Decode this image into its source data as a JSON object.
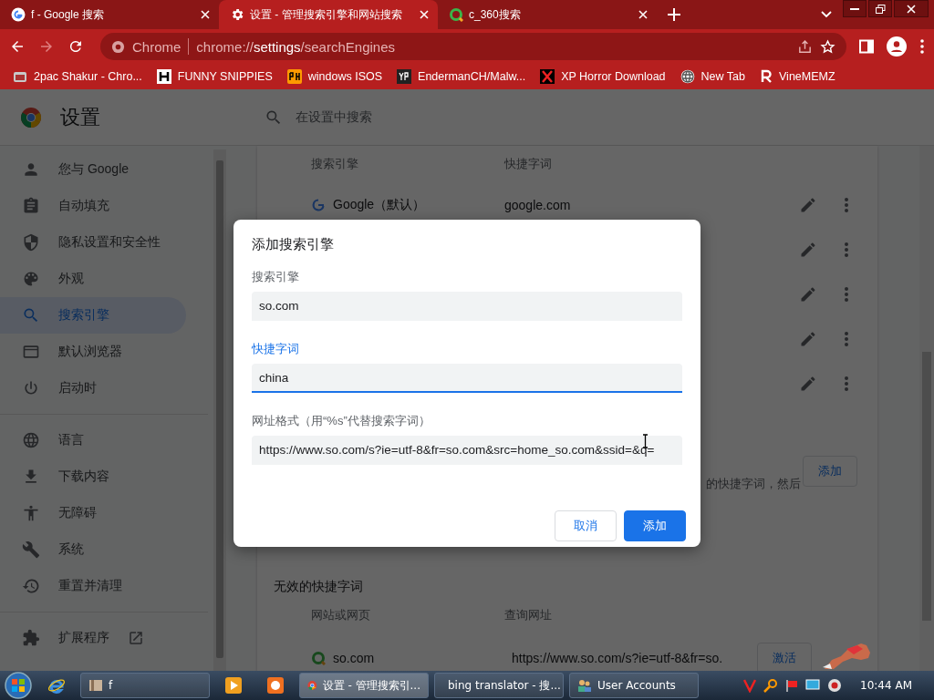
{
  "tabs": [
    {
      "title": "f - Google 搜索",
      "selected": false
    },
    {
      "title": "设置 - 管理搜索引擎和网站搜索",
      "selected": true
    },
    {
      "title": "c_360搜索",
      "selected": false
    }
  ],
  "toolbar": {
    "chip": "Chrome",
    "url": {
      "scheme": "chrome://",
      "host": "settings",
      "path": "/searchEngines"
    }
  },
  "bookmarks": [
    "2pac Shakur - Chro...",
    "FUNNY SNIPPIES",
    "windows ISOS",
    "EndermanCH/Malw...",
    "XP Horror Download",
    "New Tab",
    "VineMEMZ"
  ],
  "settings": {
    "title": "设置",
    "search": {
      "placeholder": "在设置中搜索"
    },
    "sidebar": {
      "groups": [
        [
          {
            "label": "您与 Google",
            "selected": false,
            "external": false
          },
          {
            "label": "自动填充",
            "selected": false,
            "external": false
          },
          {
            "label": "隐私设置和安全性",
            "selected": false,
            "external": false
          },
          {
            "label": "外观",
            "selected": false,
            "external": false
          },
          {
            "label": "搜索引擎",
            "selected": true,
            "external": false
          },
          {
            "label": "默认浏览器",
            "selected": false,
            "external": false
          },
          {
            "label": "启动时",
            "selected": false,
            "external": false
          }
        ],
        [
          {
            "label": "语言",
            "selected": false,
            "external": false
          },
          {
            "label": "下载内容",
            "selected": false,
            "external": false
          },
          {
            "label": "无障碍",
            "selected": false,
            "external": false
          },
          {
            "label": "系统",
            "selected": false,
            "external": false
          },
          {
            "label": "重置并清理",
            "selected": false,
            "external": false
          }
        ],
        [
          {
            "label": "扩展程序",
            "selected": false,
            "external": true
          }
        ]
      ]
    },
    "engines": {
      "columns": [
        "搜索引擎",
        "快捷字词"
      ],
      "rows": [
        {
          "name": "Google（默认）",
          "keyword": "google.com"
        },
        {},
        {},
        {},
        {}
      ]
    },
    "site_search": {
      "description": "的快捷字词，然后",
      "button": "添加"
    },
    "inactive": {
      "title": "无效的快捷字词",
      "columns": [
        "网站或网页",
        "查询网址"
      ],
      "rows": [
        {
          "name": "so.com",
          "url": "https://www.so.com/s?ie=utf-8&fr=so.",
          "button": "激活"
        }
      ]
    }
  },
  "dialog": {
    "title": "添加搜索引擎",
    "fields": [
      {
        "label": "搜索引擎",
        "value": "so.com",
        "focused": false
      },
      {
        "label": "快捷字词",
        "value": "china",
        "focused": true
      },
      {
        "label": "网址格式（用“%s”代替搜索字词）",
        "value": "https://www.so.com/s?ie=utf-8&fr=so.com&src=home_so.com&ssid=&q=",
        "focused": false
      }
    ],
    "buttons": [
      {
        "label": "取消",
        "kind": "secondary"
      },
      {
        "label": "添加",
        "kind": "primary"
      }
    ]
  },
  "taskbar": {
    "items": [
      {
        "label": "f",
        "selected": false
      },
      {
        "label": "设置 - 管理搜索引...",
        "selected": true
      },
      {
        "label": "bing translator - 搜...",
        "selected": false
      },
      {
        "label": "User Accounts",
        "selected": false
      }
    ],
    "clock": "10:44 AM"
  }
}
